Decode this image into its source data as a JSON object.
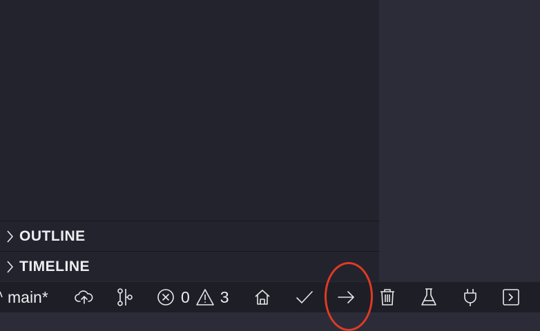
{
  "sidebar": {
    "sections": [
      {
        "label": "OUTLINE"
      },
      {
        "label": "TIMELINE"
      }
    ]
  },
  "statusbar": {
    "branch": {
      "label": "main*",
      "icon": "git-branch-icon"
    },
    "sync": {
      "icon": "cloud-upload-icon"
    },
    "graph": {
      "icon": "git-graph-icon"
    },
    "problems": {
      "errors": "0",
      "warnings": "3",
      "error_icon": "error-circle-icon",
      "warning_icon": "warning-triangle-icon"
    },
    "home": {
      "icon": "home-icon"
    },
    "check": {
      "icon": "check-icon"
    },
    "arrow": {
      "icon": "arrow-right-icon"
    },
    "trash": {
      "icon": "trash-icon"
    },
    "flask": {
      "icon": "flask-icon"
    },
    "plug": {
      "icon": "plug-icon"
    },
    "terminal": {
      "icon": "terminal-icon"
    }
  },
  "colors": {
    "sidebar_bg": "#23232d",
    "editor_bg": "#2b2c38",
    "statusbar_bg": "#1e1e26",
    "annotation": "#e13a25"
  }
}
